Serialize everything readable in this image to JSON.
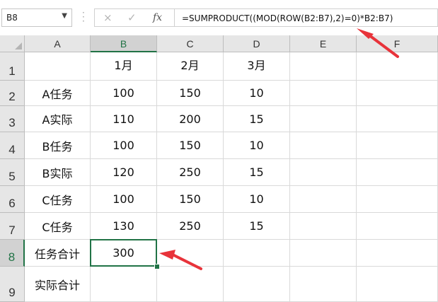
{
  "formula_bar": {
    "name_box": "B8",
    "formula": "=SUMPRODUCT((MOD(ROW(B2:B7),2)=0)*B2:B7)",
    "cancel_icon": "×",
    "enter_icon": "✓",
    "fx_label": "fx"
  },
  "sheet": {
    "columns": [
      "A",
      "B",
      "C",
      "D",
      "E",
      "F"
    ],
    "rows": [
      "1",
      "2",
      "3",
      "4",
      "5",
      "6",
      "7",
      "8",
      "9"
    ],
    "selected_cell": "B8",
    "cells": [
      [
        "",
        "1月",
        "2月",
        "3月",
        "",
        ""
      ],
      [
        "A任务",
        "100",
        "150",
        "10",
        "",
        ""
      ],
      [
        "A实际",
        "110",
        "200",
        "15",
        "",
        ""
      ],
      [
        "B任务",
        "100",
        "150",
        "10",
        "",
        ""
      ],
      [
        "B实际",
        "120",
        "250",
        "15",
        "",
        ""
      ],
      [
        "C任务",
        "100",
        "150",
        "10",
        "",
        ""
      ],
      [
        "C任务",
        "130",
        "250",
        "15",
        "",
        ""
      ],
      [
        "任务合计",
        "300",
        "",
        "",
        "",
        ""
      ],
      [
        "实际合计",
        "",
        "",
        "",
        "",
        ""
      ]
    ]
  },
  "annotations": {
    "arrow_color": "#e8333a"
  }
}
